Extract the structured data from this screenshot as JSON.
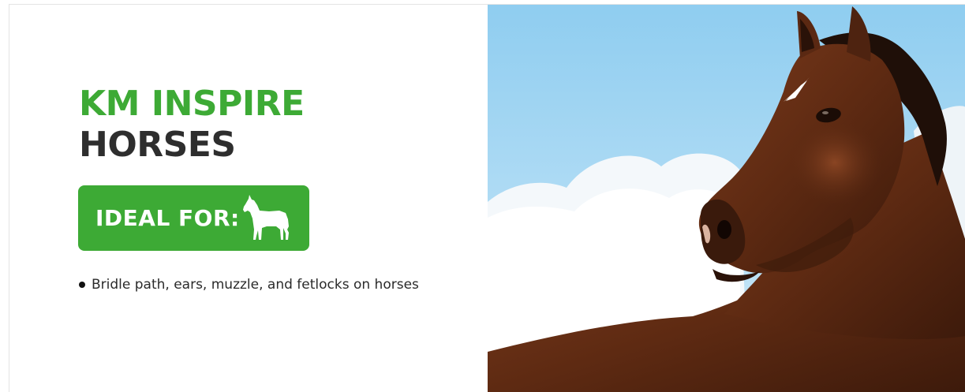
{
  "banner": {
    "title_line_1": "KM INSPIRE",
    "title_line_2": "HORSES",
    "ideal_label": "IDEAL FOR:",
    "ideal_icon": "horse-icon",
    "bullets": [
      "Bridle path, ears, muzzle, and fetlocks on horses"
    ],
    "photo_subject": "bay-horse-photo"
  },
  "colors": {
    "brand_green": "#3daa35",
    "title_dark": "#2e2e2e",
    "sky": "#a9d8f2",
    "horse_coat": "#6b2e14"
  }
}
